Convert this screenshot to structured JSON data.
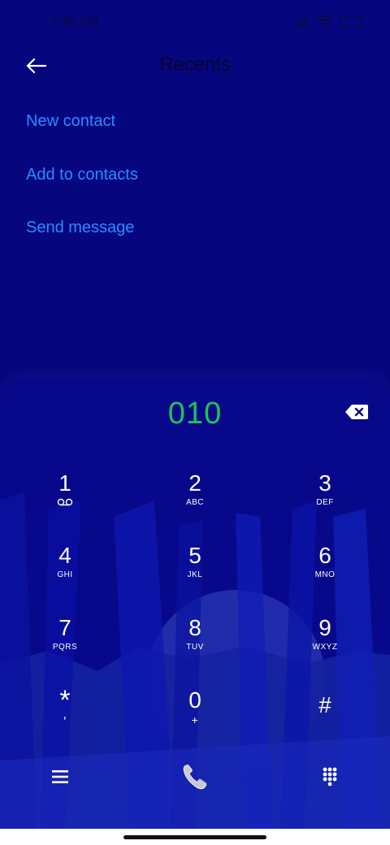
{
  "status": {
    "time": "2:36 AM"
  },
  "header": {
    "title": "Recents"
  },
  "actions": [
    {
      "label": "New contact"
    },
    {
      "label": "Add to contacts"
    },
    {
      "label": "Send message"
    }
  ],
  "dialpad": {
    "number": "010",
    "keys": [
      {
        "digit": "1",
        "letters": "",
        "icon": "voicemail-icon"
      },
      {
        "digit": "2",
        "letters": "ABC"
      },
      {
        "digit": "3",
        "letters": "DEF"
      },
      {
        "digit": "4",
        "letters": "GHI"
      },
      {
        "digit": "5",
        "letters": "JKL"
      },
      {
        "digit": "6",
        "letters": "MNO"
      },
      {
        "digit": "7",
        "letters": "PQRS"
      },
      {
        "digit": "8",
        "letters": "TUV"
      },
      {
        "digit": "9",
        "letters": "WXYZ"
      },
      {
        "digit": "*",
        "letters": ","
      },
      {
        "digit": "0",
        "letters": "+"
      },
      {
        "digit": "#",
        "letters": ""
      }
    ],
    "bottom_icons": [
      "menu-icon",
      "phone-call-icon",
      "dialpad-grid-icon"
    ]
  },
  "colors": {
    "background": "#06067f",
    "link": "#2a8cff",
    "number": "#1fc45a"
  }
}
